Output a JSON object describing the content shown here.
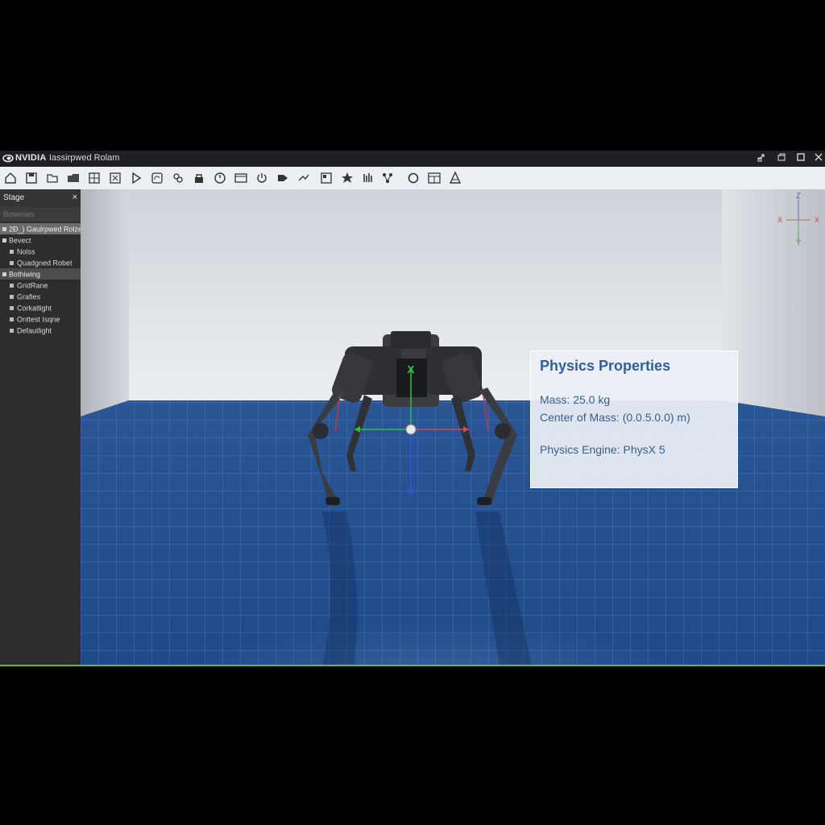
{
  "titlebar": {
    "brand": "NVIDIA",
    "title": "Iassirpwed Rolam",
    "buttons": [
      "restore-icon",
      "minimize-icon",
      "maximize-icon",
      "close-icon"
    ]
  },
  "toolbar": {
    "icons": [
      "home-icon",
      "save-icon",
      "folder-icon",
      "grid-icon",
      "frame-icon",
      "play-icon",
      "rotate-icon",
      "link-icon",
      "lock-icon",
      "timer-icon",
      "panel-icon",
      "power-icon",
      "camera-icon",
      "arrows-icon",
      "layout-icon",
      "star-icon",
      "bars-icon",
      "nodes-icon",
      "refresh-icon",
      "window-icon",
      "cone-icon"
    ]
  },
  "stage": {
    "header": "Stage",
    "close": "×",
    "search_placeholder": "Botwinies",
    "items": [
      {
        "label": "2Ð_) Gaulrpwed Rolze",
        "style": "sel",
        "indent": 0
      },
      {
        "label": "Bevect",
        "style": "plain",
        "indent": 0
      },
      {
        "label": "Nolss",
        "style": "plain",
        "indent": 1
      },
      {
        "label": "Quadgned Robet",
        "style": "plain",
        "indent": 1
      },
      {
        "label": "Bothiwing",
        "style": "grp",
        "indent": 0
      },
      {
        "label": "GridRane",
        "style": "plain",
        "indent": 1
      },
      {
        "label": "Grafies",
        "style": "plain",
        "indent": 1
      },
      {
        "label": "Corkatlight",
        "style": "plain",
        "indent": 1
      },
      {
        "label": "Onttest Isqne",
        "style": "plain",
        "indent": 1
      },
      {
        "label": "Defautlight",
        "style": "plain",
        "indent": 1
      }
    ]
  },
  "viewport": {
    "axis_labels": {
      "z": "Z",
      "x_left": "X",
      "x_right": "X",
      "y": "Y"
    },
    "gizmo_label": "X"
  },
  "physics_panel": {
    "title": "Physics Properties",
    "mass": "Mass: 25.0 kg",
    "center_of_mass": "Center  of Mass: (0.0.5.0.0) m)",
    "engine": "Physics Engine: PhysX 5"
  },
  "colors": {
    "accent_green": "#76b900",
    "floor_blue": "#1f4f8f",
    "panel_title": "#2f5f9e"
  }
}
